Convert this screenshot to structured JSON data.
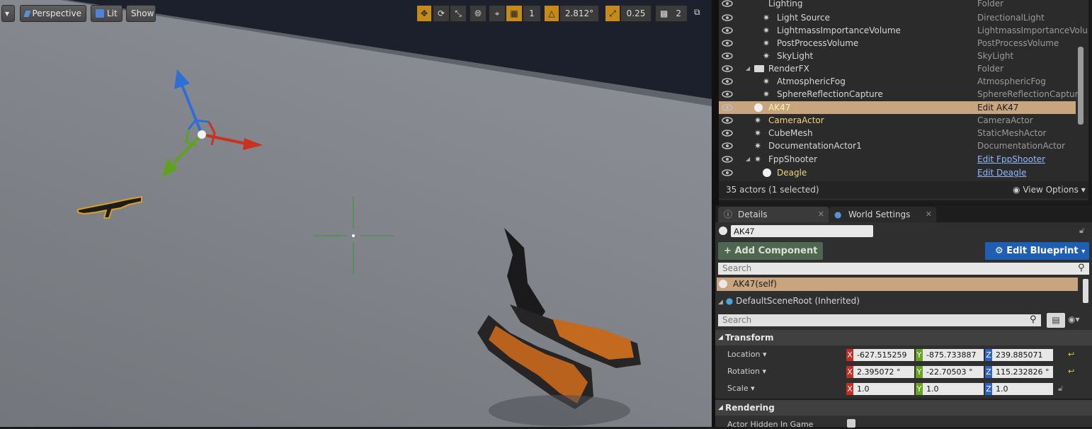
{
  "viewport": {
    "menu_arrow": "▾",
    "perspective_label": "Perspective",
    "lit_label": "Lit",
    "show_label": "Show",
    "rotation_snap": "2.812°",
    "scale_snap": "0.25",
    "camera_speed": "2",
    "icons": [
      "translate-icon",
      "rotate-icon",
      "scale-icon",
      "world-local-icon",
      "surface-snap-icon",
      "grid-snap-icon",
      "rotation-snap-icon",
      "scale-snap-icon",
      "camera-speed-icon",
      "maximize-icon"
    ]
  },
  "outliner": {
    "header_label": "Lighting",
    "header_type": "Folder",
    "rows": [
      {
        "name": "Light Source",
        "type": "DirectionalLight",
        "indent": 2,
        "icon": "directional-light-icon"
      },
      {
        "name": "LightmassImportanceVolume",
        "type": "LightmassImportanceVolu",
        "indent": 2,
        "icon": "volume-icon"
      },
      {
        "name": "PostProcessVolume",
        "type": "PostProcessVolume",
        "indent": 2,
        "icon": "postprocess-icon"
      },
      {
        "name": "SkyLight",
        "type": "SkyLight",
        "indent": 2,
        "icon": "skylight-icon"
      },
      {
        "name": "RenderFX",
        "type": "Folder",
        "indent": 1,
        "icon": "folder-icon"
      },
      {
        "name": "AtmosphericFog",
        "type": "AtmosphericFog",
        "indent": 2,
        "icon": "fog-icon"
      },
      {
        "name": "SphereReflectionCapture",
        "type": "SphereReflectionCapture",
        "indent": 2,
        "icon": "reflection-icon"
      },
      {
        "name": "AK47",
        "type": "Edit AK47",
        "indent": 1,
        "icon": "blueprint-actor-icon",
        "selected": true
      },
      {
        "name": "CameraActor",
        "type": "CameraActor",
        "indent": 1,
        "icon": "camera-icon"
      },
      {
        "name": "CubeMesh",
        "type": "StaticMeshActor",
        "indent": 1,
        "icon": "mesh-icon"
      },
      {
        "name": "DocumentationActor1",
        "type": "DocumentationActor",
        "indent": 1,
        "icon": "documentation-icon"
      },
      {
        "name": "FppShooter",
        "type": "Edit FppShooter",
        "indent": 1,
        "icon": "character-icon",
        "link": true
      },
      {
        "name": "Deagle",
        "type": "Edit Deagle",
        "indent": 2,
        "icon": "blueprint-actor-icon",
        "link": true
      }
    ],
    "count_text": "35 actors (1 selected)",
    "view_options": "View Options"
  },
  "details": {
    "tab_details": "Details",
    "tab_world": "World Settings",
    "actor_name": "AK47",
    "add_component": "Add Component",
    "edit_blueprint": "Edit Blueprint",
    "search_placeholder": "Search",
    "component_self": "AK47(self)",
    "component_root": "DefaultSceneRoot (Inherited)",
    "search2_placeholder": "Search",
    "transform_header": "Transform",
    "location_label": "Location",
    "rotation_label": "Rotation",
    "scale_label": "Scale",
    "location": {
      "x": "-627.515259",
      "y": "-875.733887",
      "z": "239.885071"
    },
    "rotation": {
      "x": "2.395072 °",
      "y": "-22.70503 °",
      "z": "115.232826 °"
    },
    "scale": {
      "x": "1.0",
      "y": "1.0",
      "z": "1.0"
    },
    "rendering_header": "Rendering",
    "actor_hidden_label": "Actor Hidden In Game",
    "axis_x": "X",
    "axis_y": "Y",
    "axis_z": "Z"
  },
  "colors": {
    "selection": "#c8a57f",
    "accent_blue": "#1e5fb4",
    "link": "#8fb8ff",
    "axis_x": "#c42d1f",
    "axis_y": "#6aa31f",
    "axis_z": "#2f62c7",
    "snap_orange": "#c58b1a"
  }
}
